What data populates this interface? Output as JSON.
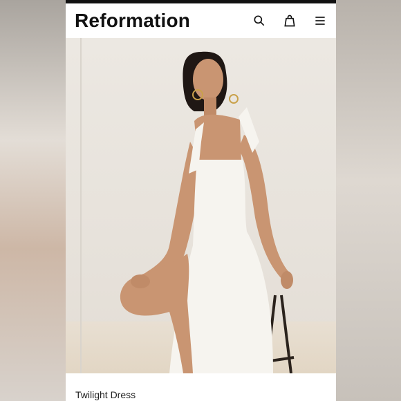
{
  "header": {
    "logo": "Reformation",
    "icons": [
      "search-icon",
      "shopping-bag-icon",
      "menu-icon"
    ]
  },
  "product": {
    "title": "Twilight Dress",
    "image_alt": "Model wearing white dress seated on a stool"
  },
  "colors": {
    "text": "#111111",
    "background": "#ffffff",
    "dress": "#f6f4ef",
    "skin": "#c99572"
  }
}
